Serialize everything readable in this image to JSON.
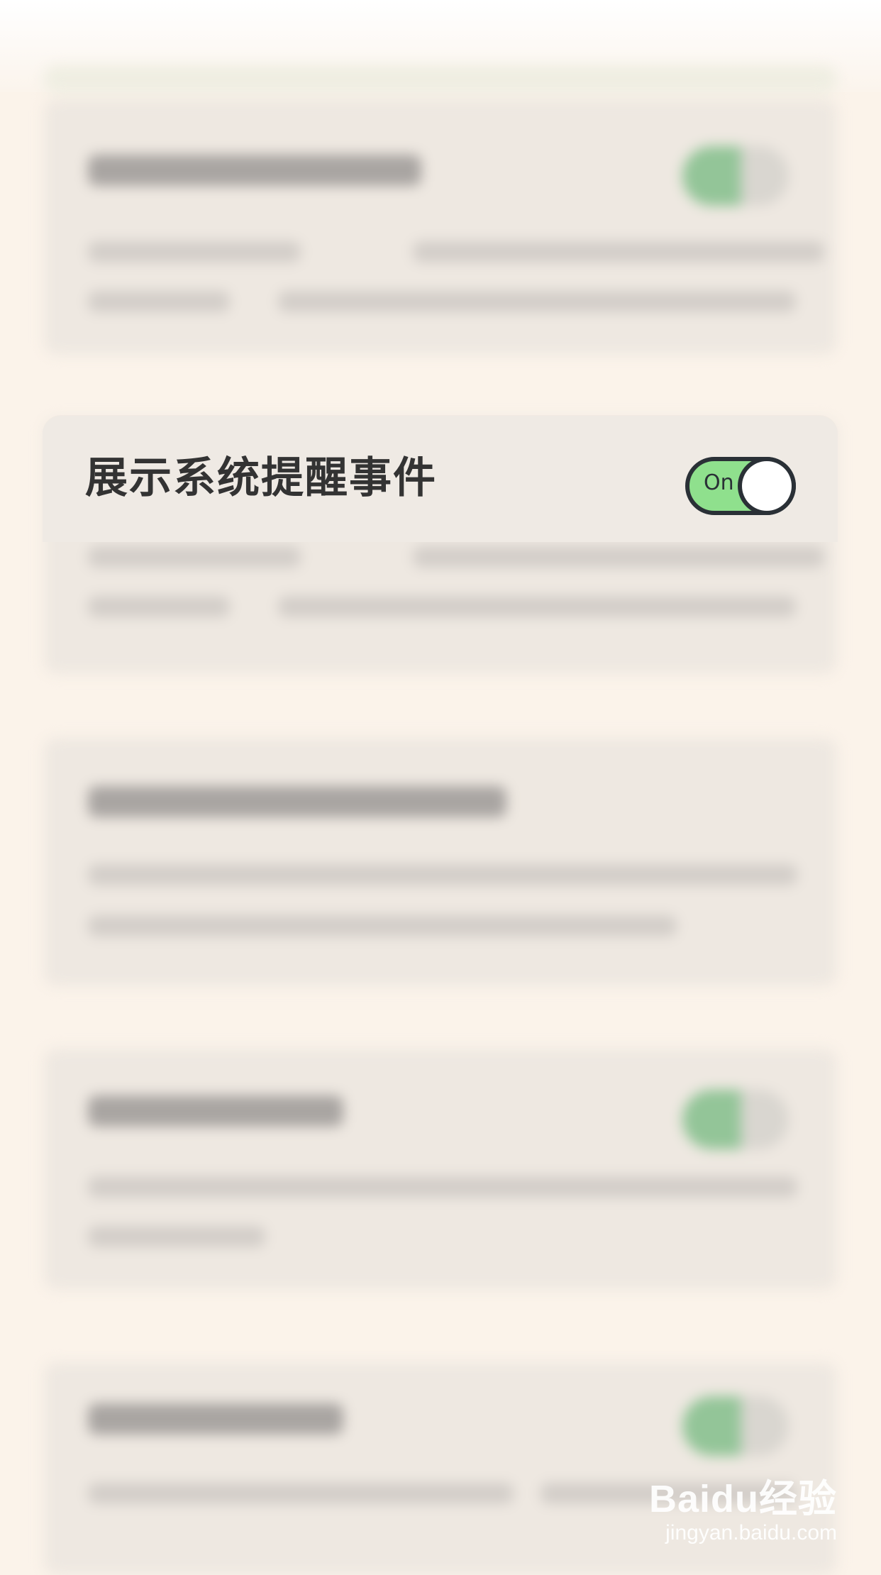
{
  "setting": {
    "title": "展示系统提醒事件",
    "toggle_label": "On",
    "toggle_state": "on"
  },
  "watermark": {
    "logo": "Baidu经验",
    "url": "jingyan.baidu.com"
  },
  "colors": {
    "background": "#fbf3ea",
    "card": "#efeae4",
    "toggle_on": "#8fe08d",
    "toggle_border": "#2a3036",
    "title_text": "#333333"
  }
}
